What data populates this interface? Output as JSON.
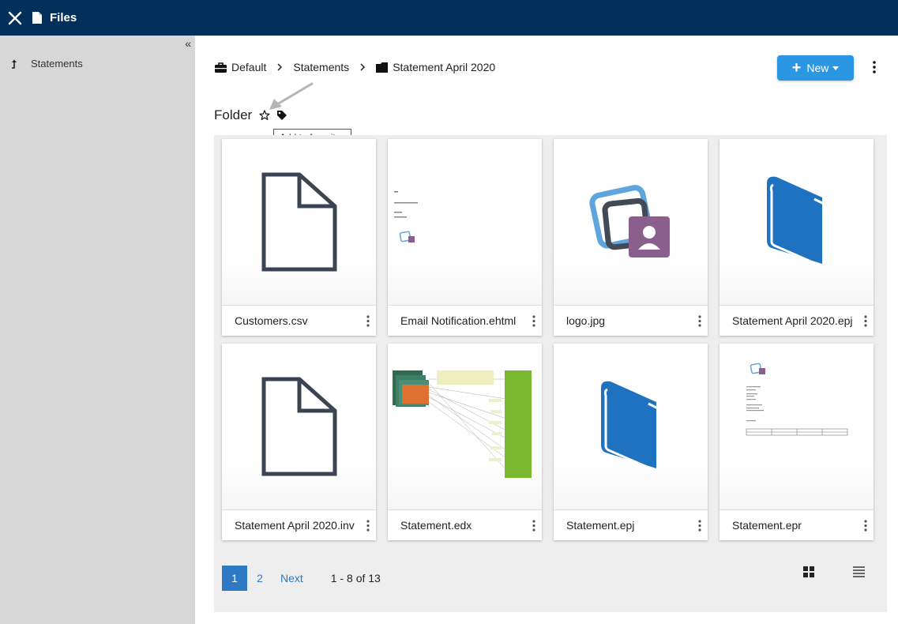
{
  "topbar": {
    "title": "Files",
    "close_icon": "close-icon",
    "file_icon": "file-icon"
  },
  "sidebar": {
    "collapse_label": "«",
    "items": [
      {
        "label": "Statements",
        "icon": "level-up-icon"
      }
    ]
  },
  "breadcrumb": [
    {
      "label": "Default",
      "icon": "briefcase-icon"
    },
    {
      "label": "Statements"
    },
    {
      "label": "Statement April 2020",
      "icon": "folder-icon"
    }
  ],
  "toolbar": {
    "new_label": "New",
    "accent": "#2b97e2"
  },
  "folder": {
    "label": "Folder",
    "tooltip": "Add to favorites"
  },
  "files": [
    {
      "name": "Customers.csv",
      "thumb": "document-outline-icon"
    },
    {
      "name": "Email Notification.ehtml",
      "thumb": "email-preview"
    },
    {
      "name": "logo.jpg",
      "thumb": "logo-image"
    },
    {
      "name": "Statement April 2020.epj",
      "thumb": "book-icon"
    },
    {
      "name": "Statement April 2020.inv",
      "thumb": "document-outline-icon"
    },
    {
      "name": "Statement.edx",
      "thumb": "data-mapping-diagram"
    },
    {
      "name": "Statement.epj",
      "thumb": "book-icon"
    },
    {
      "name": "Statement.epr",
      "thumb": "report-preview"
    }
  ],
  "pagination": {
    "pages": [
      "1",
      "2"
    ],
    "current": "1",
    "next_label": "Next",
    "count_label": "1 - 8 of 13"
  },
  "colors": {
    "topbar": "#00305a",
    "sidebar": "#d7d7d7",
    "book": "#1e72c0",
    "doc_outline": "#3a4452",
    "logo_purple": "#8a5f8e",
    "link": "#2f78c4"
  }
}
